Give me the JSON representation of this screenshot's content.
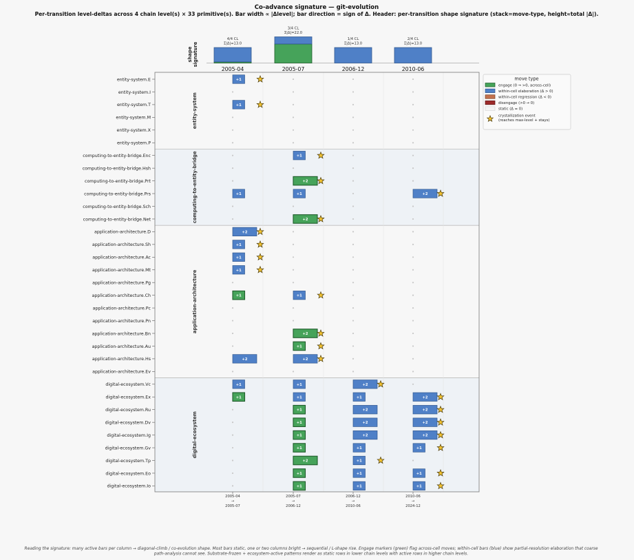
{
  "chart_data": {
    "type": "bar",
    "title": "Co-advance signature — git-evolution",
    "subtitle": "Per-transition level-deltas across 4 chain level(s) × 33 primitive(s).  Bar width ∝ |Δlevel|; bar direction = sign of Δ.  Header: per-transition shape signature (stack=move-type, height∝total |Δ|).",
    "header_label": "shape\nsignature",
    "columns": [
      {
        "label": "2005-04",
        "footer": [
          "2005-04",
          "→",
          "2005-07"
        ],
        "cl": "4/4 CL",
        "sum": "Σ|Δ|=13.0",
        "total": 13,
        "engage": 1,
        "elab": 12
      },
      {
        "label": "2005-07",
        "footer": [
          "2005-07",
          "→",
          "2006-12"
        ],
        "cl": "3/4 CL",
        "sum": "Σ|Δ|=22.0",
        "total": 22,
        "engage": 16,
        "elab": 6
      },
      {
        "label": "2006-12",
        "footer": [
          "2006-12",
          "→",
          "2010-06"
        ],
        "cl": "1/4 CL",
        "sum": "Σ|Δ|=13.0",
        "total": 13,
        "engage": 0,
        "elab": 13
      },
      {
        "label": "2010-06",
        "footer": [
          "2010-06",
          "→",
          "2024-12"
        ],
        "cl": "2/4 CL",
        "sum": "Σ|Δ|=13.0",
        "total": 13,
        "engage": 0,
        "elab": 13
      }
    ],
    "groups": [
      {
        "name": "entity-system",
        "rows": [
          {
            "label": "entity-system.E",
            "cells": [
              [
                "E",
                1,
                1
              ],
              null,
              null,
              null
            ]
          },
          {
            "label": "entity-system.I",
            "cells": [
              null,
              null,
              null,
              null
            ]
          },
          {
            "label": "entity-system.T",
            "cells": [
              [
                "E",
                1,
                1
              ],
              null,
              null,
              null
            ]
          },
          {
            "label": "entity-system.M",
            "cells": [
              null,
              null,
              null,
              null
            ]
          },
          {
            "label": "entity-system.X",
            "cells": [
              null,
              null,
              null,
              null
            ]
          },
          {
            "label": "entity-system.P",
            "cells": [
              null,
              null,
              null,
              null
            ]
          }
        ]
      },
      {
        "name": "computing-to-entity-bridge",
        "rows": [
          {
            "label": "computing-to-entity-bridge.Enc",
            "cells": [
              null,
              [
                "E",
                1,
                1
              ],
              null,
              null
            ]
          },
          {
            "label": "computing-to-entity-bridge.Hsh",
            "cells": [
              null,
              null,
              null,
              null
            ]
          },
          {
            "label": "computing-to-entity-bridge.Prt",
            "cells": [
              null,
              [
                "G",
                2,
                1
              ],
              null,
              null
            ]
          },
          {
            "label": "computing-to-entity-bridge.Prs",
            "cells": [
              [
                "E",
                1,
                0
              ],
              [
                "E",
                1,
                0
              ],
              null,
              [
                "E",
                2,
                1
              ]
            ]
          },
          {
            "label": "computing-to-entity-bridge.Sch",
            "cells": [
              null,
              null,
              null,
              null
            ]
          },
          {
            "label": "computing-to-entity-bridge.Net",
            "cells": [
              null,
              [
                "G",
                2,
                1
              ],
              null,
              null
            ]
          }
        ]
      },
      {
        "name": "application-architecture",
        "rows": [
          {
            "label": "application-architecture.D",
            "cells": [
              [
                "E",
                2,
                1
              ],
              null,
              null,
              null
            ]
          },
          {
            "label": "application-architecture.Sh",
            "cells": [
              [
                "E",
                1,
                1
              ],
              null,
              null,
              null
            ]
          },
          {
            "label": "application-architecture.Ac",
            "cells": [
              [
                "E",
                1,
                1
              ],
              null,
              null,
              null
            ]
          },
          {
            "label": "application-architecture.Mt",
            "cells": [
              [
                "E",
                1,
                1
              ],
              null,
              null,
              null
            ]
          },
          {
            "label": "application-architecture.Pg",
            "cells": [
              null,
              null,
              null,
              null
            ]
          },
          {
            "label": "application-architecture.Ch",
            "cells": [
              [
                "G",
                1,
                0
              ],
              [
                "E",
                1,
                1
              ],
              null,
              null
            ]
          },
          {
            "label": "application-architecture.Pc",
            "cells": [
              null,
              null,
              null,
              null
            ]
          },
          {
            "label": "application-architecture.Pn",
            "cells": [
              null,
              null,
              null,
              null
            ]
          },
          {
            "label": "application-architecture.Bn",
            "cells": [
              null,
              [
                "G",
                2,
                1
              ],
              null,
              null
            ]
          },
          {
            "label": "application-architecture.Au",
            "cells": [
              null,
              [
                "G",
                1,
                1
              ],
              null,
              null
            ]
          },
          {
            "label": "application-architecture.Hs",
            "cells": [
              [
                "E",
                2,
                0
              ],
              [
                "E",
                2,
                1
              ],
              null,
              null
            ]
          },
          {
            "label": "application-architecture.Ev",
            "cells": [
              null,
              null,
              null,
              null
            ]
          }
        ]
      },
      {
        "name": "digital-ecosystem",
        "rows": [
          {
            "label": "digital-ecosystem.Vc",
            "cells": [
              [
                "E",
                1,
                0
              ],
              [
                "E",
                1,
                0
              ],
              [
                "E",
                2,
                1
              ],
              null
            ]
          },
          {
            "label": "digital-ecosystem.Ex",
            "cells": [
              [
                "G",
                1,
                0
              ],
              [
                "E",
                1,
                0
              ],
              [
                "E",
                1,
                0
              ],
              [
                "E",
                2,
                1
              ]
            ]
          },
          {
            "label": "digital-ecosystem.Ru",
            "cells": [
              null,
              [
                "G",
                1,
                0
              ],
              [
                "E",
                2,
                0
              ],
              [
                "E",
                2,
                1
              ]
            ]
          },
          {
            "label": "digital-ecosystem.Dv",
            "cells": [
              null,
              [
                "G",
                1,
                0
              ],
              [
                "E",
                2,
                0
              ],
              [
                "E",
                2,
                1
              ]
            ]
          },
          {
            "label": "digital-ecosystem.Ig",
            "cells": [
              null,
              [
                "G",
                1,
                0
              ],
              [
                "E",
                2,
                0
              ],
              [
                "E",
                2,
                1
              ]
            ]
          },
          {
            "label": "digital-ecosystem.Gv",
            "cells": [
              null,
              [
                "G",
                1,
                0
              ],
              [
                "E",
                1,
                0
              ],
              [
                "E",
                1,
                1
              ]
            ]
          },
          {
            "label": "digital-ecosystem.Tp",
            "cells": [
              null,
              [
                "G",
                2,
                0
              ],
              [
                "E",
                1,
                1
              ],
              null
            ]
          },
          {
            "label": "digital-ecosystem.Eo",
            "cells": [
              null,
              [
                "G",
                1,
                0
              ],
              [
                "E",
                1,
                0
              ],
              [
                "E",
                1,
                1
              ]
            ]
          },
          {
            "label": "digital-ecosystem.Io",
            "cells": [
              null,
              [
                "G",
                1,
                0
              ],
              [
                "E",
                1,
                0
              ],
              [
                "E",
                1,
                1
              ]
            ]
          }
        ]
      }
    ],
    "legend": {
      "title": "move type",
      "placement": "right",
      "items": [
        {
          "kind": "G",
          "label": "engage  (0 → >0, across-cell)"
        },
        {
          "kind": "E",
          "label": "within-cell elaboration  (Δ > 0)"
        },
        {
          "kind": "R",
          "label": "within-cell regression  (Δ < 0)"
        },
        {
          "kind": "D",
          "label": "disengage  (>0 → 0)"
        },
        {
          "kind": "S",
          "label": "static  (Δ = 0)"
        },
        {
          "kind": "C",
          "label": "crystallization event\n(reaches max-level + stays)"
        }
      ]
    },
    "footnote": "Reading the signature: many active bars per column → diagonal-climb / co-evolution shape.  Most bars static, one or two columns bright → sequential / L-shape rise.  Engage markers (green) flag across-cell moves; within-cell bars (blue) show partial-resolution elaboration that coarse path-analysis cannot see.  Substrate-frozen + ecosystem-active patterns render as static rows in lower chain levels with active rows in higher chain levels.",
    "colors": {
      "engage": "#46a35a",
      "engage_edge": "#1e5c2a",
      "elab": "#4f80c7",
      "elab_edge": "#33598f",
      "regress": "#c2714e",
      "disengage": "#9e2b2b",
      "star": "#f2c230",
      "band": "#eef2f6"
    }
  }
}
